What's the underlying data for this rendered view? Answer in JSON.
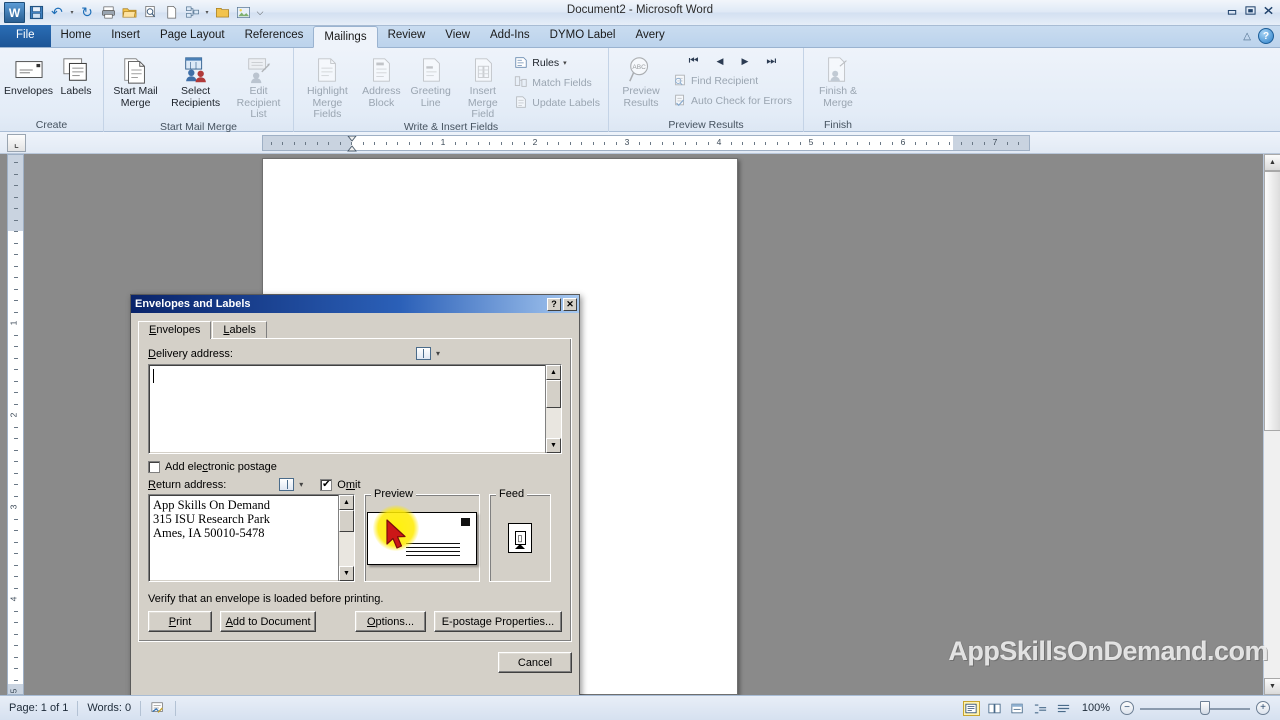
{
  "window": {
    "title": "Document2 - Microsoft Word",
    "minimize_label": "–",
    "restore_label": "❐",
    "close_label": "✕"
  },
  "quick_access": [
    {
      "name": "word-logo-icon",
      "glyph": "W"
    },
    {
      "name": "save-icon",
      "glyph": "💾"
    },
    {
      "name": "undo-icon",
      "glyph": "↶"
    },
    {
      "name": "undo-dropdown-icon",
      "glyph": "▾"
    },
    {
      "name": "redo-icon",
      "glyph": "↻"
    },
    {
      "name": "print-icon",
      "glyph": "⎙"
    },
    {
      "name": "open-icon",
      "glyph": "📂"
    },
    {
      "name": "print-preview-icon",
      "glyph": "⎘"
    },
    {
      "name": "new-icon",
      "glyph": "⎇"
    },
    {
      "name": "mail-merge-icon",
      "glyph": "⌘"
    },
    {
      "name": "mail-merge-dropdown-icon",
      "glyph": "▾"
    },
    {
      "name": "folder-icon",
      "glyph": "🗀"
    },
    {
      "name": "picture-icon",
      "glyph": "❑"
    },
    {
      "name": "customize-qat-icon",
      "glyph": "⌵"
    }
  ],
  "ribbon": {
    "tabs": [
      {
        "label": "File",
        "active": false,
        "file": true
      },
      {
        "label": "Home",
        "active": false
      },
      {
        "label": "Insert",
        "active": false
      },
      {
        "label": "Page Layout",
        "active": false
      },
      {
        "label": "References",
        "active": false
      },
      {
        "label": "Mailings",
        "active": true
      },
      {
        "label": "Review",
        "active": false
      },
      {
        "label": "View",
        "active": false
      },
      {
        "label": "Add-Ins",
        "active": false
      },
      {
        "label": "DYMO Label",
        "active": false
      },
      {
        "label": "Avery",
        "active": false
      }
    ],
    "collapse_icon": "△",
    "help_icon": "?",
    "groups": [
      {
        "name": "create",
        "label": "Create",
        "buttons": [
          {
            "label": "Envelopes",
            "icon": "envelope-icon",
            "dropdown": false
          },
          {
            "label": "Labels",
            "icon": "labels-icon",
            "dropdown": false
          }
        ]
      },
      {
        "name": "start-mail-merge",
        "label": "Start Mail Merge",
        "buttons": [
          {
            "label": "Start Mail\nMerge",
            "icon": "start-mail-merge-icon",
            "dropdown": true
          },
          {
            "label": "Select\nRecipients",
            "icon": "select-recipients-icon",
            "dropdown": true
          },
          {
            "label": "Edit\nRecipient List",
            "icon": "edit-recipient-list-icon",
            "dropdown": false,
            "disabled": true
          }
        ]
      },
      {
        "name": "write-insert-fields",
        "label": "Write & Insert Fields",
        "buttons": [
          {
            "label": "Highlight\nMerge Fields",
            "icon": "highlight-merge-fields-icon",
            "disabled": true
          },
          {
            "label": "Address\nBlock",
            "icon": "address-block-icon",
            "disabled": true
          },
          {
            "label": "Greeting\nLine",
            "icon": "greeting-line-icon",
            "disabled": true
          },
          {
            "label": "Insert Merge\nField",
            "icon": "insert-merge-field-icon",
            "disabled": true
          }
        ],
        "small_buttons": [
          {
            "label": "Rules",
            "icon": "rules-icon",
            "dropdown": true
          },
          {
            "label": "Match Fields",
            "icon": "match-fields-icon",
            "disabled": true
          },
          {
            "label": "Update Labels",
            "icon": "update-labels-icon",
            "disabled": true
          }
        ]
      },
      {
        "name": "preview-results",
        "label": "Preview Results",
        "buttons": [
          {
            "label": "Preview\nResults",
            "icon": "preview-results-icon",
            "disabled": true
          }
        ],
        "nav": [
          {
            "name": "first-record-button",
            "glyph": "⏮"
          },
          {
            "name": "previous-record-button",
            "glyph": "◀"
          },
          {
            "name": "next-record-button",
            "glyph": "▶"
          },
          {
            "name": "last-record-button",
            "glyph": "⏭"
          }
        ],
        "small_buttons": [
          {
            "label": "Find Recipient",
            "icon": "find-recipient-icon",
            "disabled": true
          },
          {
            "label": "Auto Check for Errors",
            "icon": "auto-check-errors-icon",
            "disabled": true
          }
        ]
      },
      {
        "name": "finish",
        "label": "Finish",
        "buttons": [
          {
            "label": "Finish &\nMerge",
            "icon": "finish-merge-icon",
            "dropdown": true,
            "disabled": true
          }
        ]
      }
    ]
  },
  "ruler": {
    "tab_selector_glyph": "⌞",
    "horizontal_numbers": [
      "1",
      "2",
      "3",
      "4",
      "5",
      "6",
      "7"
    ],
    "vertical_numbers": [
      "1",
      "2",
      "3",
      "4",
      "5"
    ]
  },
  "dialog": {
    "title": "Envelopes and Labels",
    "help_glyph": "?",
    "close_glyph": "✕",
    "tabs": [
      {
        "label": "Envelopes",
        "selected": true
      },
      {
        "label": "Labels",
        "selected": false
      }
    ],
    "delivery_address": {
      "label": "Delivery address:",
      "value": "",
      "book_icon": "address-book-icon",
      "dropdown_glyph": "▾",
      "scroll_up_glyph": "▲",
      "scroll_down_glyph": "▼"
    },
    "electronic_postage": {
      "label": "Add electronic postage",
      "checked": false
    },
    "return_address": {
      "label": "Return address:",
      "value": "App Skills On Demand\n315 ISU Research Park\nAmes,  IA  50010-5478",
      "book_icon": "address-book-icon",
      "dropdown_glyph": "▾",
      "omit_label": "Omit",
      "omit_checked": true,
      "scroll_up_glyph": "▲",
      "scroll_down_glyph": "▼"
    },
    "preview": {
      "title": "Preview"
    },
    "feed": {
      "title": "Feed"
    },
    "verify_text": "Verify that an envelope is loaded before printing.",
    "buttons": [
      {
        "name": "print-button",
        "label": "Print"
      },
      {
        "name": "add-to-document-button",
        "label": "Add to Document"
      },
      {
        "name": "options-button",
        "label": "Options..."
      },
      {
        "name": "e-postage-properties-button",
        "label": "E-postage Properties..."
      }
    ],
    "cancel_label": "Cancel"
  },
  "watermark": "AppSkillsOnDemand.com",
  "statusbar": {
    "page": "Page: 1 of 1",
    "words": "Words: 0",
    "proofing_icon": "proofing-errors-icon",
    "views": [
      {
        "name": "print-layout-view-button",
        "glyph": "▤",
        "selected": true
      },
      {
        "name": "full-screen-reading-view-button",
        "glyph": "◫",
        "selected": false
      },
      {
        "name": "web-layout-view-button",
        "glyph": "▣",
        "selected": false
      },
      {
        "name": "outline-view-button",
        "glyph": "≣",
        "selected": false
      },
      {
        "name": "draft-view-button",
        "glyph": "≡",
        "selected": false
      }
    ],
    "zoom_level": "100%",
    "zoom_out_glyph": "−",
    "zoom_in_glyph": "+"
  },
  "colors": {
    "dialog_face": "#d4d0c8",
    "dialog_title_start": "#0a246a",
    "ribbon_accent": "#2a6db5",
    "highlight_yellow": "#ffeb00",
    "cursor_red": "#d11a1a"
  }
}
